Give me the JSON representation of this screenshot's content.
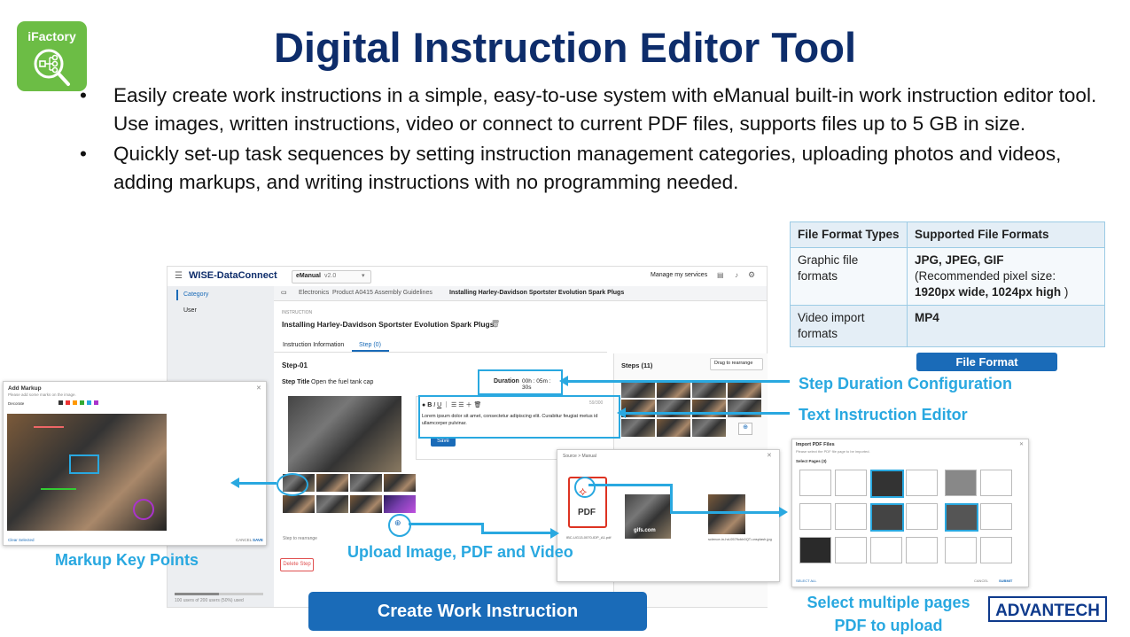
{
  "logo": {
    "label": "iFactory"
  },
  "title": "Digital Instruction Editor Tool",
  "bullets": [
    "Easily create work instructions in a simple, easy-to-use system with eManual built-in work instruction editor tool. Use images, written instructions, video or connect to current PDF files, supports files up to 5 GB in size.",
    "Quickly set-up task sequences by setting instruction management categories, uploading photos and videos, adding markups, and writing instructions with no programming needed."
  ],
  "format_table": {
    "headers": [
      "File Format Types",
      "Supported File Formats"
    ],
    "rows": [
      {
        "type": "Graphic file formats",
        "formats": "JPG, JPEG, GIF",
        "note_prefix": "(Recommended pixel size:",
        "note_bold": "1920px wide, 1024px high",
        "note_suffix": ")"
      },
      {
        "type": "Video import formats",
        "formats": "MP4"
      }
    ],
    "button": "File Format"
  },
  "app": {
    "brand": "WISE-DataConnect",
    "module": "eManual",
    "version": "v2.0",
    "manage": "Manage my services",
    "sidebar": [
      "Category",
      "User"
    ],
    "breadcrumb": [
      "Electronics",
      "Product A0415 Assembly Guidelines",
      "Installing Harley-Davidson Sportster Evolution Spark Plugs"
    ],
    "section_label": "INSTRUCTION",
    "heading": "Installing Harley-Davidson Sportster Evolution Spark Plugs",
    "tabs": [
      "Instruction Information",
      "Step (0)"
    ],
    "step_name": "Step-01",
    "step_title_label": "Step Title",
    "step_title_value": "Open the fuel tank cap",
    "duration_label": "Duration",
    "duration_value": "00h : 05m : 30s",
    "editor_text": "Lorem ipsum dolor sit amet, consectetur adipiscing elit. Curabitur feugiat metus id ullamcorper pulvinar.",
    "editor_count": "59/300",
    "save": "Save",
    "steps_title": "Steps (11)",
    "drag_label": "Drag to rearrange",
    "step_rearrange": "Step to rearrange",
    "delete_step": "Delete Step",
    "footer_note": "100 users of 200 users (50%) used"
  },
  "markup_panel": {
    "title": "Add Markup",
    "subtitle": "Please add some marks on the image.",
    "toolbar_label": "Decorate",
    "clear": "Clear Selected",
    "cancel": "CANCEL",
    "save": "SAVE"
  },
  "file_dialog": {
    "path": "Source > Manual",
    "pdf_label": "PDF",
    "pdf_name": "IBC-UG13-0070-IDP_A1.pdf",
    "video_name": "gifs.com",
    "photo_name": "science-in-hd-0579cbb0QT-unsplash.jpg"
  },
  "pdf_panel": {
    "title": "Import PDF Files",
    "subtitle": "Please select the PDF file page to be imported.",
    "pages_label": "Select Pages (3)",
    "select_all": "SELECT ALL",
    "cancel": "CANCEL",
    "submit": "SUBMIT"
  },
  "callouts": {
    "duration": "Step Duration Configuration",
    "text_editor": "Text Instruction Editor",
    "markup": "Markup Key Points",
    "upload": "Upload Image, PDF and Video",
    "pdf_line1": "Select multiple pages",
    "pdf_line2": "PDF to upload"
  },
  "create_button": "Create Work Instruction",
  "brand_logo": "ADVANTECH",
  "colors": {
    "title": "#0e2d6b",
    "accent": "#29a8e0",
    "button": "#1a6bb8",
    "logo_green": "#6cbd45"
  }
}
